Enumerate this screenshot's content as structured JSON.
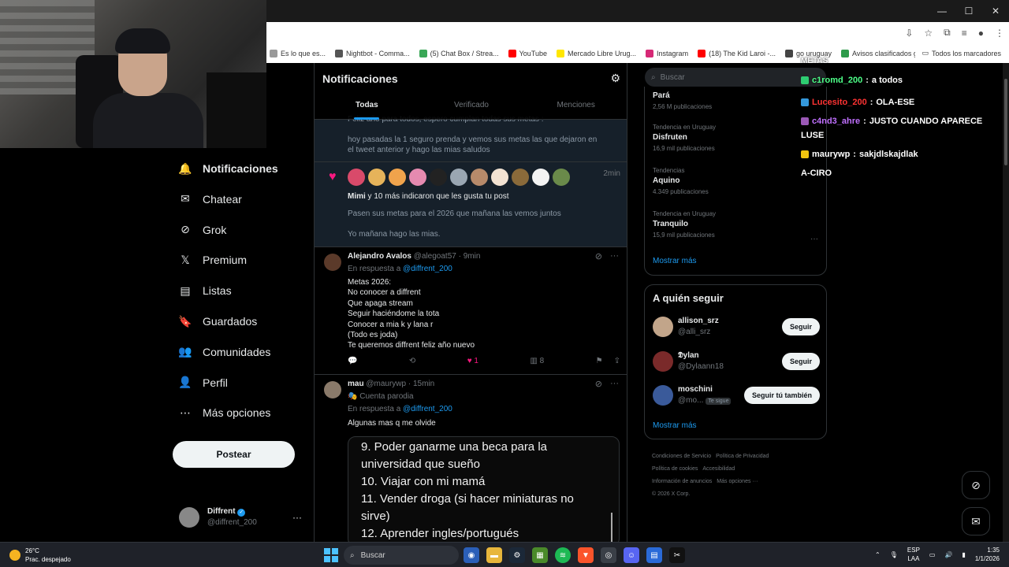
{
  "browser": {
    "bookmarks": [
      {
        "label": "Es lo que es...",
        "color": "#999999"
      },
      {
        "label": "Nightbot - Comma...",
        "color": "#555555"
      },
      {
        "label": "(5) Chat Box / Strea...",
        "color": "#3aa757"
      },
      {
        "label": "YouTube",
        "color": "#ff0000"
      },
      {
        "label": "Mercado Libre Urug...",
        "color": "#ffe600"
      },
      {
        "label": "Instagram",
        "color": "#d62976"
      },
      {
        "label": "(18) The Kid Laroi -...",
        "color": "#ff0000"
      },
      {
        "label": "go uruguay",
        "color": "#444444"
      },
      {
        "label": "Avisos clasificados g...",
        "color": "#2e9b4b"
      }
    ],
    "all_bookmarks": "Todos los marcadores"
  },
  "nav": {
    "items": [
      {
        "label": "Notificaciones",
        "icon": "bell-icon",
        "glyph": "🔔",
        "active": true
      },
      {
        "label": "Chatear",
        "icon": "mail-icon",
        "glyph": "✉",
        "active": false
      },
      {
        "label": "Grok",
        "icon": "grok-icon",
        "glyph": "⊘",
        "active": false
      },
      {
        "label": "Premium",
        "icon": "x-logo-icon",
        "glyph": "𝕏",
        "active": false
      },
      {
        "label": "Listas",
        "icon": "list-icon",
        "glyph": "▤",
        "active": false
      },
      {
        "label": "Guardados",
        "icon": "bookmark-icon",
        "glyph": "🔖",
        "active": false
      },
      {
        "label": "Comunidades",
        "icon": "communities-icon",
        "glyph": "👥",
        "active": false
      },
      {
        "label": "Perfil",
        "icon": "person-icon",
        "glyph": "👤",
        "active": false
      },
      {
        "label": "Más opciones",
        "icon": "more-circle-icon",
        "glyph": "⋯",
        "active": false
      }
    ],
    "post_button": "Postear",
    "profile": {
      "name": "Diffrent",
      "handle": "@diffrent_200"
    }
  },
  "main": {
    "title": "Notificaciones",
    "tabs": [
      "Todas",
      "Verificado",
      "Menciones"
    ],
    "partial_notif": {
      "line1": "Feliz año para todos, espero cumplan todas sus metas :",
      "line2": "hoy pasadas la 1 seguro prenda y vemos sus metas las que dejaron en el tweet anterior y hago las mias saludos"
    },
    "likes_notif": {
      "time": "2min",
      "who": "Mimi",
      "text": " y 10 más indicaron que les gusta tu post",
      "line2": "Pasen sus metas para el 2026 que mañana las vemos juntos",
      "line3": "Yo mañana hago las mias.",
      "avatar_colors": [
        "#d94a6a",
        "#e6b35a",
        "#f0a34c",
        "#e58ab0",
        "#222222",
        "#9aa6b2",
        "#b78a6a",
        "#f2e2d2",
        "#8a6a3a",
        "#f3f3f3",
        "#6a8a4a"
      ]
    },
    "tweet1": {
      "name": "Alejandro Avalos",
      "handle": "@alegoat57",
      "time": "9min",
      "reply_prefix": "En respuesta a",
      "reply_to": "@diffrent_200",
      "lines": [
        "Metas 2026:",
        "No conocer a diffrent",
        "Que apaga stream",
        "Seguir haciéndome la tota",
        "Conocer a mia k y lana r",
        "(Todo es joda)",
        "Te queremos diffrent feliz año nuevo"
      ],
      "likes": "1",
      "views": "8"
    },
    "tweet2": {
      "name": "mau",
      "handle": "@maurywp",
      "time": "15min",
      "parody": "Cuenta parodia",
      "reply_prefix": "En respuesta a",
      "reply_to": "@diffrent_200",
      "text": "Algunas mas q me olvide",
      "media_lines": [
        "9. Poder ganarme una beca para la",
        "universidad que sueño",
        "10. Viajar con mi mamá",
        "11. Vender droga (si hacer miniaturas no",
        "sirve)",
        "12. Aprender ingles/portugués"
      ]
    }
  },
  "right": {
    "search_placeholder": "Buscar",
    "trends": [
      {
        "context": "",
        "title": "Pará",
        "count": "2,56 M publicaciones"
      },
      {
        "context": "Tendencia en Uruguay",
        "title": "Disfruten",
        "count": "16,9 mil publicaciones"
      },
      {
        "context": "Tendencias",
        "title": "Aquino",
        "count": "4.349 publicaciones"
      },
      {
        "context": "Tendencia en Uruguay",
        "title": "Tranquilo",
        "count": "15,9 mil publicaciones"
      }
    ],
    "show_more": "Mostrar más",
    "who_to_follow": {
      "title": "A quién seguir",
      "users": [
        {
          "name": "allison_srz",
          "handle": "@alli_srz",
          "button": "Seguir",
          "follows_you": ""
        },
        {
          "name": "𝕯ylan",
          "handle": "@Dylaann18",
          "button": "Seguir",
          "follows_you": ""
        },
        {
          "name": "moschini",
          "handle": "@mo...",
          "button": "Seguir tú también",
          "follows_you": "Te sigue"
        }
      ],
      "show_more": "Mostrar más"
    },
    "footer": [
      "Condiciones de Servicio",
      "Política de Privacidad",
      "Política de cookies",
      "Accesibilidad",
      "Información de anuncios",
      "Más opciones ···",
      "© 2026 X Corp."
    ]
  },
  "chat": {
    "header": "METAS",
    "messages": [
      {
        "user": "c1romd_200",
        "text": "a todos",
        "color": "#4dff88"
      },
      {
        "user": "Lucesito_200",
        "text": "OLA-ESE",
        "color": "#ff3333"
      },
      {
        "user": "c4nd3_ahre",
        "text": "JUSTO CUANDO APARECE",
        "color": "#c070ff"
      },
      {
        "user": "",
        "text": "LUSE",
        "color": "#ffffff"
      },
      {
        "user": "maurywp",
        "text": "sakjdlskajdlak",
        "color": "#ffffff"
      },
      {
        "user": "",
        "text": "A-CIRO",
        "color": "#ffffff"
      }
    ]
  },
  "taskbar": {
    "temp": "26°C",
    "weather": "Prac. despejado",
    "search": "Buscar",
    "lang1": "ESP",
    "lang2": "LAA",
    "time": "1:35",
    "date": "1/1/2026"
  }
}
